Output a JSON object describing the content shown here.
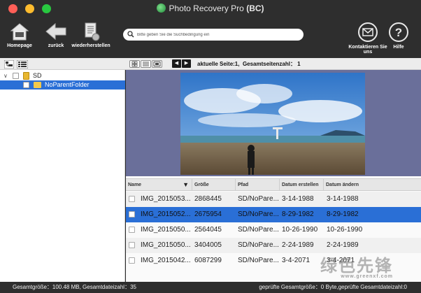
{
  "window": {
    "title": "Photo Recovery Pro",
    "title_suffix": "(BC)"
  },
  "toolbar": {
    "home_label": "Homepage",
    "back_label": "zurück",
    "restore_label": "wiederherstellen",
    "contact_label_1": "Kontaktieren Sie",
    "contact_label_2": "uns",
    "help_label": "Hilfe"
  },
  "search": {
    "placeholder": "Bitte geben Sie die Suchbedingung ein",
    "value": ""
  },
  "pagination": {
    "current_label": "aktuelle Seite:1,",
    "total_label": "Gesamtseitenzahl： 1"
  },
  "tree": {
    "root_label": "SD",
    "child_label": "NoParentFolder"
  },
  "table": {
    "columns": [
      "Name",
      "Größe",
      "Pfad",
      "Datum erstellen",
      "Datum ändern"
    ],
    "rows": [
      {
        "name": "IMG_2015053...",
        "size": "2868445",
        "path": "SD/NoPare...",
        "created": "3-14-1988",
        "modified": "3-14-1988"
      },
      {
        "name": "IMG_2015052...",
        "size": "2675954",
        "path": "SD/NoPare...",
        "created": "8-29-1982",
        "modified": "8-29-1982"
      },
      {
        "name": "IMG_2015050...",
        "size": "2564045",
        "path": "SD/NoPare...",
        "created": "10-26-1990",
        "modified": "10-26-1990"
      },
      {
        "name": "IMG_2015050...",
        "size": "3404005",
        "path": "SD/NoPare...",
        "created": "2-24-1989",
        "modified": "2-24-1989"
      },
      {
        "name": "IMG_2015042...",
        "size": "6087299",
        "path": "SD/NoPare...",
        "created": "3-4-2071",
        "modified": "3-4-2071"
      }
    ]
  },
  "status": {
    "left": "Gesamtgröße：100.48 MB,  Gesamtdateizahl：35",
    "right": "geprüfte Gesamtgröße：0 Byte,geprüfte Gesamtdateizahl:0"
  },
  "watermark": {
    "text": "绿色先锋",
    "url": "www.greenxf.com"
  },
  "colors": {
    "selection": "#2a6fd6",
    "preview_bg": "#6a6f9a",
    "chrome": "#2e2e2e"
  }
}
